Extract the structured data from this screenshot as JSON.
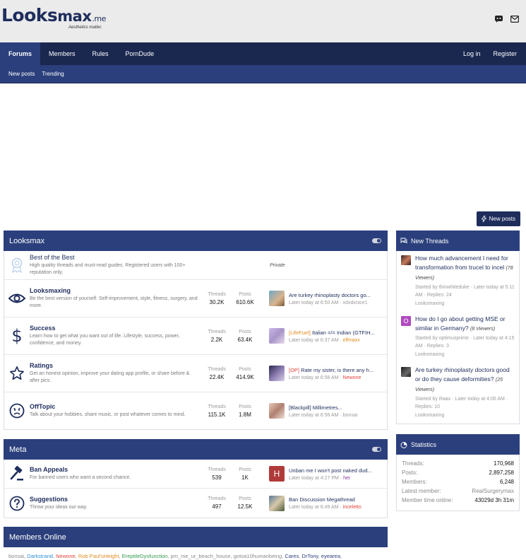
{
  "brand": {
    "logo_part1": "Looks",
    "logo_part2": "max",
    "logo_part3": ".me",
    "tagline": "Aesthetics matter."
  },
  "nav": {
    "tabs": [
      {
        "label": "Forums"
      },
      {
        "label": "Members"
      },
      {
        "label": "Rules"
      },
      {
        "label": "PornDude"
      }
    ],
    "login": "Log in",
    "register": "Register"
  },
  "subnav": {
    "new_posts": "New posts",
    "trending": "Trending"
  },
  "new_posts_button": "New posts",
  "looksmax": {
    "title": "Looksmax",
    "nodes": [
      {
        "title": "Best of the Best",
        "desc": "High quality threads and must-read guides. Registered users with 100+ reputation only.",
        "private": "Private"
      },
      {
        "title": "Looksmaxing",
        "desc": "Be the best version of yourself. Self-improvement, style, fitness, surgery, and more.",
        "threads": "30.2K",
        "posts": "610.6K",
        "last_title": "Are turkey rhinoplasty doctors go...",
        "last_time": "Later today at 6:50 AM",
        "last_user": "xdxdxnice1"
      },
      {
        "title": "Success",
        "desc": "Learn how to get what you want out of life. Lifestyle, success, power, confidence, and money.",
        "threads": "2.2K",
        "posts": "63.4K",
        "last_prefix": "[LifeFuel]",
        "last_title": "Italian =/= Indian (GTFIH...",
        "last_time": "Later today at 6:37 AM",
        "last_user": "elfmaxx"
      },
      {
        "title": "Ratings",
        "desc": "Get an honest opinion, improve your dating app profile, or share before & after pics.",
        "threads": "22.4K",
        "posts": "414.9K",
        "last_prefix": "[OP]",
        "last_title": "Rate my sister, is there any h...",
        "last_time": "Later today at 6:56 AM",
        "last_user": "Newone"
      },
      {
        "title": "OffTopic",
        "desc": "Talk about your hobbies, share music, or post whatever comes to mind.",
        "threads": "115.1K",
        "posts": "1.8M",
        "last_title": "[Blackpill] Millimetres...",
        "last_time": "Later today at 6:56 AM",
        "last_user": "bonsai"
      }
    ]
  },
  "meta": {
    "title": "Meta",
    "nodes": [
      {
        "title": "Ban Appeals",
        "desc": "For banned users who want a second chance.",
        "threads": "539",
        "posts": "1K",
        "last_title": "Unban me I won't post naked dud...",
        "last_time": "Later today at 4:27 PM",
        "last_user": "her",
        "avatar_letter": "H"
      },
      {
        "title": "Suggestions",
        "desc": "Throw your ideas our way.",
        "threads": "497",
        "posts": "12.5K",
        "last_title": "Ban Discussion Megathread",
        "last_time": "Later today at 6:49 AM",
        "last_user": "inceletto"
      }
    ]
  },
  "labels": {
    "threads": "Threads",
    "posts": "Posts"
  },
  "members_online": {
    "title": "Members Online",
    "users": [
      {
        "name": "bonsai",
        "color": "#8a8a8a"
      },
      {
        "name": "Darkstrand",
        "color": "#2a8fd6"
      },
      {
        "name": "Newone",
        "color": "#e0443a"
      },
      {
        "name": "Rob Paul'sHeight",
        "color": "#e08a1e"
      },
      {
        "name": "EreptileDysfunction",
        "color": "#2e9a4a"
      },
      {
        "name": "pm_me_ur_beach_house",
        "color": "#8a8a8a"
      },
      {
        "name": "gotoa10humanbeing",
        "color": "#8a8a8a"
      },
      {
        "name": "Cares",
        "color": "#2b3f7c"
      },
      {
        "name": "DrTony",
        "color": "#2b3f7c"
      },
      {
        "name": "eyearea",
        "color": "#2b3f7c"
      }
    ]
  },
  "new_threads": {
    "title": "New Threads",
    "items": [
      {
        "title": "How much advancement I need for transformation from trucel to incel",
        "viewers": "(78 Viewers)",
        "meta": "Started by thinwhiteduke · Later today at 5:11 AM · Replies: 24",
        "forum": "Looksmaxing"
      },
      {
        "title": "How do I go about getting MSE or similar in Germany?",
        "viewers": "(8 Viewers)",
        "meta": "Started by optimusprime · Later today at 4:15 AM · Replies: 3",
        "forum": "Looksmaxing"
      },
      {
        "title": "Are turkey rhinoplasty doctors good or do they cause deformities?",
        "viewers": "(25 Viewers)",
        "meta": "Started by Raax · Later today at 4:06 AM · Replies: 10",
        "forum": "Looksmaxing"
      }
    ]
  },
  "statistics": {
    "title": "Statistics",
    "rows": [
      {
        "k": "Threads:",
        "v": "170,968"
      },
      {
        "k": "Posts:",
        "v": "2,897,258"
      },
      {
        "k": "Members:",
        "v": "6,248"
      },
      {
        "k": "Latest member:",
        "v": "RealSurgerymax"
      },
      {
        "k": "Member time online:",
        "v": "43029d 3h 31m"
      }
    ]
  },
  "colors": {
    "navy": "#1a2850",
    "blue": "#2b3f7c",
    "text_blue": "#1e2d5c"
  }
}
